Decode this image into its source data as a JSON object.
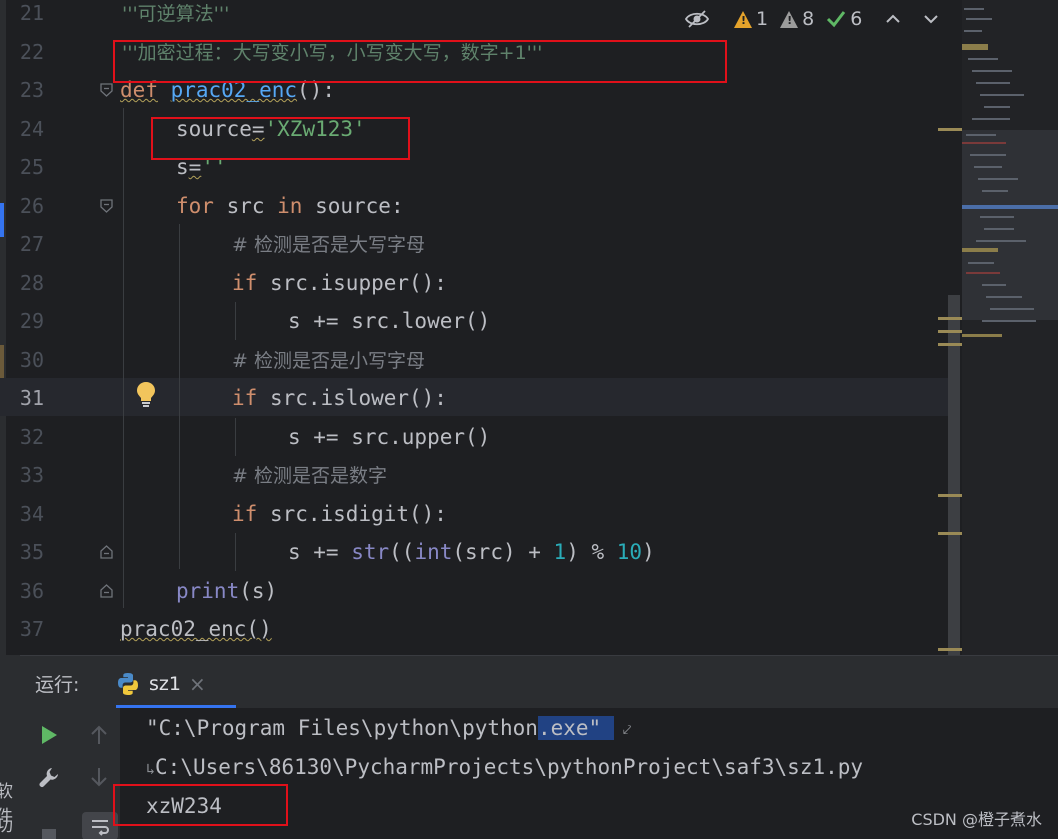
{
  "editor": {
    "line_numbers": [
      "21",
      "22",
      "23",
      "24",
      "25",
      "26",
      "27",
      "28",
      "29",
      "30",
      "31",
      "32",
      "33",
      "34",
      "35",
      "36",
      "37"
    ],
    "current_line": "31",
    "code": {
      "l21_doc": "'''可逆算法'''",
      "l22_doc": "'''加密过程：大写变小写，小写变大写，数字+1'''",
      "l23_kw": "def",
      "l23_fn": "prac02_enc",
      "l23_rest": "():",
      "l24_var": "source",
      "l24_eq": "=",
      "l24_str": "'XZw123'",
      "l25_var": "s",
      "l25_eq": "=",
      "l25_str": "''",
      "l26_for": "for",
      "l26_mid": " src ",
      "l26_in": "in",
      "l26_rest": " source:",
      "l27_cm": "# 检测是否是大写字母",
      "l28_if": "if",
      "l28_rest": " src.isupper():",
      "l29": "s += src.lower()",
      "l30_cm": "# 检测是否是小写字母",
      "l31_if": "if",
      "l31_rest": " src.islower():",
      "l32": "s += src.upper()",
      "l33_cm": "# 检测是否是数字",
      "l34_if": "if",
      "l34_rest": " src.isdigit():",
      "l35_a": "s += ",
      "l35_str": "str",
      "l35_b": "((",
      "l35_int": "int",
      "l35_c": "(src) + ",
      "l35_n1": "1",
      "l35_d": ") % ",
      "l35_n2": "10",
      "l35_e": ")",
      "l36_print": "print",
      "l36_rest": "(s)",
      "l37": "prac02_enc()"
    },
    "inspections": {
      "warnings": "1",
      "weak_warnings": "8",
      "typos": "6"
    }
  },
  "run_panel": {
    "label": "运行:",
    "tab_name": "sz1",
    "console": {
      "line1_a": "\"C:\\Program Files\\python\\python",
      "line1_sel": ".exe\" ",
      "line2": "C:\\Users\\86130\\PycharmProjects\\pythonProject\\saf3\\sz1.py",
      "line3": "xzW234"
    }
  },
  "side_labels": [
    "软件",
    "功"
  ],
  "watermark": "CSDN @橙子煮水",
  "colors": {
    "background": "#1e1f22",
    "keyword": "#cf8e6d",
    "function": "#56a8f5",
    "string": "#6aab73",
    "number": "#2aacb8",
    "comment": "#7a7e85",
    "highlight_box": "#e0101a",
    "selection": "#214283"
  }
}
